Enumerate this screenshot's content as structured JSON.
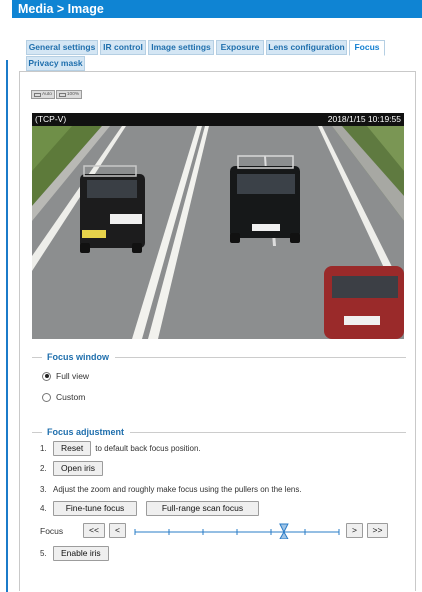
{
  "header": {
    "title": "Media  > Image"
  },
  "tabs": [
    {
      "label": "General settings"
    },
    {
      "label": "IR control"
    },
    {
      "label": "Image settings"
    },
    {
      "label": "Exposure"
    },
    {
      "label": "Lens configuration"
    },
    {
      "label": "Focus",
      "active": true
    },
    {
      "label": "Privacy mask"
    }
  ],
  "zoom": {
    "auto_label": "Auto",
    "full_label": "100%"
  },
  "video": {
    "stream_label": "(TCP-V)",
    "timestamp": "2018/1/15 10:19:55"
  },
  "focus_window": {
    "legend": "Focus window",
    "options": [
      {
        "label": "Full view",
        "selected": true
      },
      {
        "label": "Custom",
        "selected": false
      }
    ]
  },
  "focus_adjustment": {
    "legend": "Focus adjustment",
    "step1": {
      "num": "1.",
      "button": "Reset",
      "text": "to default back focus position."
    },
    "step2": {
      "num": "2.",
      "button": "Open iris"
    },
    "step3": {
      "num": "3.",
      "text": "Adjust the zoom and roughly make focus using the pullers on the lens."
    },
    "step4": {
      "num": "4.",
      "fine_tune_button": "Fine-tune focus",
      "full_range_button": "Full-range scan focus"
    },
    "focus_row": {
      "label": "Focus",
      "far_left": "<<",
      "left": "<",
      "right": ">",
      "far_right": ">>",
      "slider_position": 0.73,
      "slider_ticks": 6
    },
    "step5": {
      "num": "5.",
      "button": "Enable iris"
    }
  },
  "colors": {
    "accent": "#0f84d3",
    "tab_bg": "#d4e6f4",
    "tab_text": "#1f6fad",
    "legend_text": "#1f6fad",
    "slider": "#2a7cc7"
  }
}
